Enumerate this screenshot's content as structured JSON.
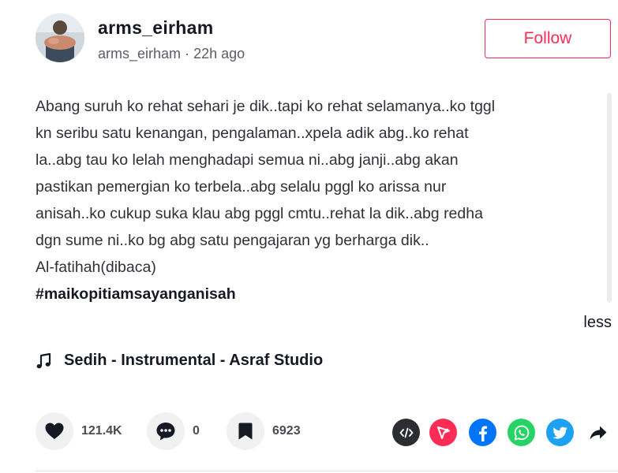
{
  "header": {
    "username": "arms_eirham",
    "handle": "arms_eirham",
    "separator": "·",
    "time_ago": "22h ago",
    "follow_label": "Follow"
  },
  "caption": {
    "lines": [
      "Abang suruh ko rehat sehari je dik..tapi ko rehat selamanya..ko tggl",
      "kn seribu satu kenangan, pengalaman..xpela adik abg..ko rehat",
      "la..abg tau ko lelah menghadapi semua ni..abg janji..abg akan",
      "pastikan pemergian ko terbela..abg selalu pggl ko arissa nur",
      "anisah..ko cukup suka klau abg pggl cmtu..rehat la dik..abg redha",
      "dgn sume ni..ko bg abg satu pengajaran yg berharga dik..",
      "Al-fatihah(dibaca)"
    ],
    "hashtag": "#maikopitiamsayanganisah",
    "less_label": "less"
  },
  "music": {
    "title": "Sedih - Instrumental - Asraf Studio",
    "icon": "music-note-icon"
  },
  "actions": {
    "likes": "121.4K",
    "comments": "0",
    "saves": "6923"
  },
  "share": {
    "icons": [
      "embed-icon",
      "send-icon",
      "facebook-icon",
      "whatsapp-icon",
      "twitter-icon",
      "share-arrow-icon"
    ]
  },
  "colors": {
    "accent": "#fe2c55",
    "embed": "#2c2d33",
    "send": "#fe2c55",
    "facebook": "#0075fa",
    "whatsapp": "#25d366",
    "twitter": "#1da1f2"
  }
}
